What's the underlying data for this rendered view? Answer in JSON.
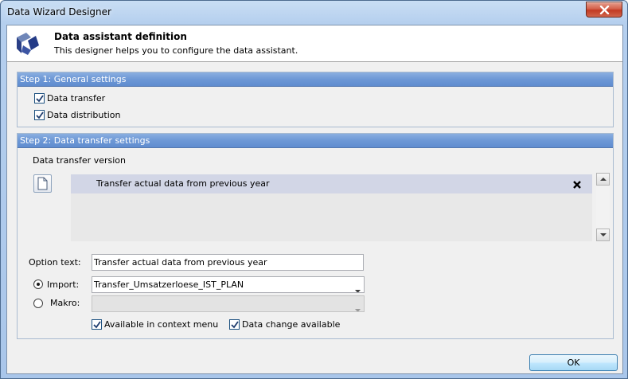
{
  "window": {
    "title": "Data Wizard Designer"
  },
  "header": {
    "title": "Data assistant definition",
    "subtitle": "This designer helps you to configure the data assistant."
  },
  "step1": {
    "title": "Step 1: General settings",
    "data_transfer_label": "Data transfer",
    "data_transfer_checked": true,
    "data_distribution_label": "Data distribution",
    "data_distribution_checked": true
  },
  "step2": {
    "title": "Step 2: Data transfer settings",
    "version_label": "Data transfer version",
    "versions": [
      {
        "label": "Transfer actual data from previous year"
      }
    ],
    "option_text_label": "Option text:",
    "option_text_value": "Transfer actual data from previous year",
    "import_label": "Import:",
    "import_selected": true,
    "import_value": "Transfer_Umsatzerloese_IST_PLAN",
    "makro_label": "Makro:",
    "makro_selected": false,
    "makro_value": "",
    "context_menu_label": "Available in context menu",
    "context_menu_checked": true,
    "data_change_label": "Data change available",
    "data_change_checked": true
  },
  "footer": {
    "ok_label": "OK"
  },
  "icons": {
    "logo": "cube-logo-icon",
    "close": "close-icon",
    "new_version": "document-icon",
    "remove_version": "close-x-icon",
    "scroll_up": "arrow-up-icon",
    "scroll_down": "arrow-down-icon",
    "combo": "chevron-down-icon"
  },
  "colors": {
    "group_header": "#6d98d6",
    "selected_row": "#d2d6e6",
    "close_button": "#c23a22"
  }
}
